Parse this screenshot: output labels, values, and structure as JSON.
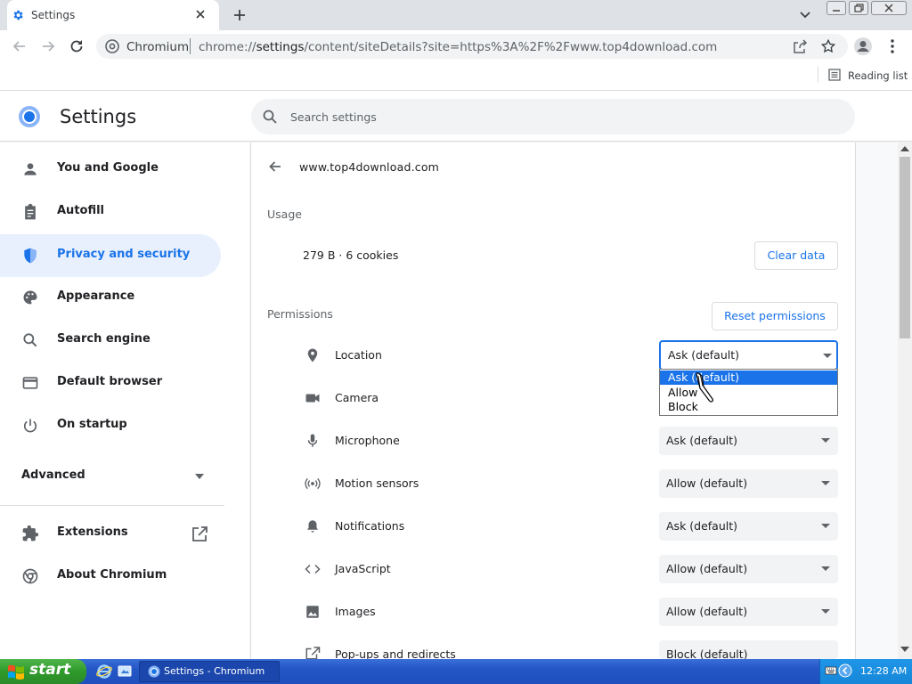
{
  "browser": {
    "tab_title": "Settings",
    "new_tab_label": "+",
    "site_chip_label": "Chromium",
    "url_prefix": "chrome://",
    "url_host": "settings",
    "url_rest": "/content/siteDetails?site=https%3A%2F%2Fwww.top4download.com",
    "reading_list_label": "Reading list"
  },
  "settings": {
    "title": "Settings",
    "search_placeholder": "Search settings"
  },
  "nav": {
    "items": [
      {
        "label": "You and Google",
        "icon": "person-icon"
      },
      {
        "label": "Autofill",
        "icon": "clipboard-icon"
      },
      {
        "label": "Privacy and security",
        "icon": "shield-icon"
      },
      {
        "label": "Appearance",
        "icon": "palette-icon"
      },
      {
        "label": "Search engine",
        "icon": "search-icon"
      },
      {
        "label": "Default browser",
        "icon": "browser-window-icon"
      },
      {
        "label": "On startup",
        "icon": "power-icon"
      }
    ],
    "advanced_label": "Advanced",
    "extensions_label": "Extensions",
    "about_label": "About Chromium"
  },
  "site": {
    "title": "www.top4download.com",
    "usage_heading": "Usage",
    "usage_text": "279 B · 6 cookies",
    "clear_data_label": "Clear data",
    "permissions_heading": "Permissions",
    "reset_permissions_label": "Reset permissions"
  },
  "permissions": [
    {
      "label": "Location",
      "value": "Ask (default)",
      "icon": "location-pin-icon"
    },
    {
      "label": "Camera",
      "value": "",
      "icon": "camera-icon"
    },
    {
      "label": "Microphone",
      "value": "Ask (default)",
      "icon": "microphone-icon"
    },
    {
      "label": "Motion sensors",
      "value": "Allow (default)",
      "icon": "motion-sensor-icon"
    },
    {
      "label": "Notifications",
      "value": "Ask (default)",
      "icon": "bell-icon"
    },
    {
      "label": "JavaScript",
      "value": "Allow (default)",
      "icon": "code-icon"
    },
    {
      "label": "Images",
      "value": "Allow (default)",
      "icon": "image-icon"
    },
    {
      "label": "Pop-ups and redirects",
      "value": "Block (default)",
      "icon": "open-in-new-icon"
    }
  ],
  "dropdown": {
    "options": [
      "Ask (default)",
      "Allow",
      "Block"
    ],
    "selected_index": 0
  },
  "taskbar": {
    "start_label": "start",
    "task_label": "Settings - Chromium",
    "clock": "12:28 AM"
  },
  "colors": {
    "accent": "#1a73e8",
    "active_nav_bg": "#e8f0fe",
    "taskbar_blue": "#2456c6",
    "start_green": "#2f9a2b"
  }
}
